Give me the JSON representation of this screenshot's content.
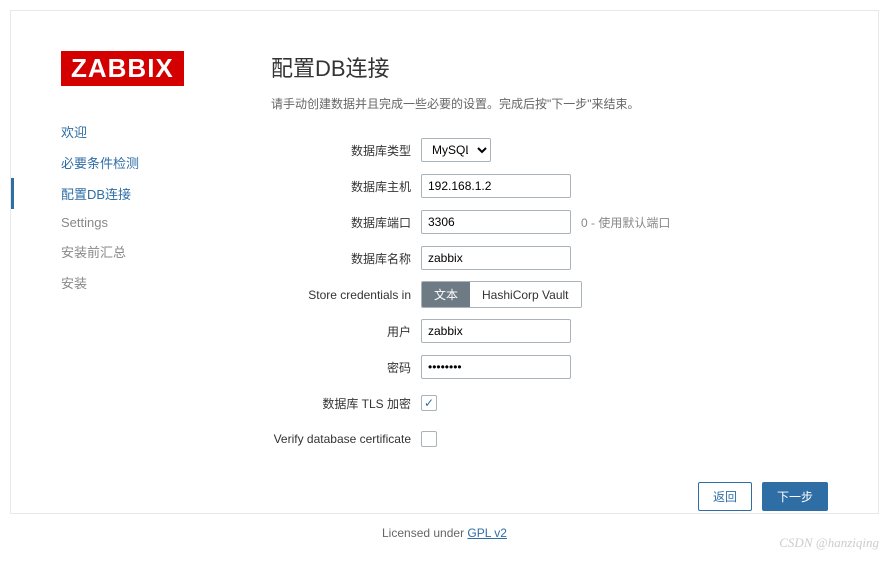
{
  "logo": "ZABBIX",
  "nav": {
    "welcome": "欢迎",
    "requirements": "必要条件检测",
    "db": "配置DB连接",
    "settings": "Settings",
    "summary": "安装前汇总",
    "install": "安装"
  },
  "header": {
    "title": "配置DB连接",
    "intro": "请手动创建数据并且完成一些必要的设置。完成后按\"下一步\"来结束。"
  },
  "form": {
    "db_type_label": "数据库类型",
    "db_type_value": "MySQL",
    "db_host_label": "数据库主机",
    "db_host_value": "192.168.1.2",
    "db_port_label": "数据库端口",
    "db_port_value": "3306",
    "db_port_hint": "0 - 使用默认端口",
    "db_name_label": "数据库名称",
    "db_name_value": "zabbix",
    "store_label": "Store credentials in",
    "store_opt_plain": "文本",
    "store_opt_vault": "HashiCorp Vault",
    "user_label": "用户",
    "user_value": "zabbix",
    "password_label": "密码",
    "password_value": "••••••••",
    "tls_label": "数据库 TLS 加密",
    "tls_checked": true,
    "verify_label": "Verify database certificate",
    "verify_checked": false
  },
  "buttons": {
    "back": "返回",
    "next": "下一步"
  },
  "license": {
    "prefix": "Licensed under ",
    "link": "GPL v2"
  },
  "watermark": "CSDN @hanziqing"
}
